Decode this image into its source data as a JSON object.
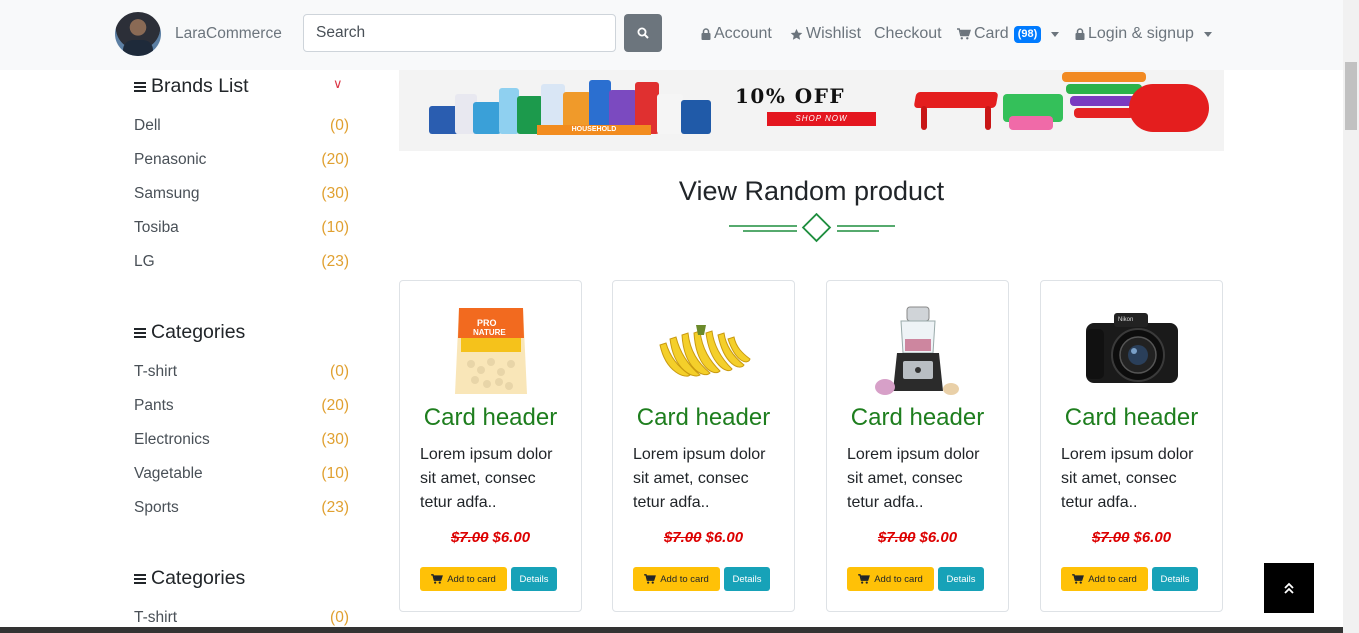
{
  "nav": {
    "brand": "LaraCommerce",
    "search_placeholder": "Search",
    "account": "Account",
    "wishlist": "Wishlist",
    "checkout": "Checkout",
    "card": "Card",
    "card_count": "(98)",
    "login": "Login & signup"
  },
  "sidebar": {
    "brands_title": "Brands List",
    "brands": [
      {
        "name": "Dell",
        "count": "(0)"
      },
      {
        "name": "Penasonic",
        "count": "(20)"
      },
      {
        "name": "Samsung",
        "count": "(30)"
      },
      {
        "name": "Tosiba",
        "count": "(10)"
      },
      {
        "name": "LG",
        "count": "(23)"
      }
    ],
    "categories_title": "Categories",
    "categories": [
      {
        "name": "T-shirt",
        "count": "(0)"
      },
      {
        "name": "Pants",
        "count": "(20)"
      },
      {
        "name": "Electronics",
        "count": "(30)"
      },
      {
        "name": "Vagetable",
        "count": "(10)"
      },
      {
        "name": "Sports",
        "count": "(23)"
      }
    ],
    "categories2_title": "Categories",
    "categories2": [
      {
        "name": "T-shirt",
        "count": "(0)"
      }
    ]
  },
  "banner": {
    "label": "HOUSEHOLD",
    "offer": "10% OFF",
    "cta": "SHOP NOW"
  },
  "main": {
    "section_title": "View Random product",
    "products": [
      {
        "image": "grocery-bag",
        "header": "Card header",
        "text": "Lorem ipsum dolor sit amet, consec tetur adfa..",
        "old_price": "$7.00",
        "price": "$6.00",
        "add_label": "Add to card",
        "details_label": "Details"
      },
      {
        "image": "bananas",
        "header": "Card header",
        "text": "Lorem ipsum dolor sit amet, consec tetur adfa..",
        "old_price": "$7.00",
        "price": "$6.00",
        "add_label": "Add to card",
        "details_label": "Details"
      },
      {
        "image": "food-processor",
        "header": "Card header",
        "text": "Lorem ipsum dolor sit amet, consec tetur adfa..",
        "old_price": "$7.00",
        "price": "$6.00",
        "add_label": "Add to card",
        "details_label": "Details"
      },
      {
        "image": "camera",
        "header": "Card header",
        "text": "Lorem ipsum dolor sit amet, consec tetur adfa..",
        "old_price": "$7.00",
        "price": "$6.00",
        "add_label": "Add to card",
        "details_label": "Details"
      }
    ]
  },
  "colors": {
    "accent_green": "#1e7e1e",
    "price_red": "#dc0000",
    "add_button": "#ffc107",
    "details_button": "#17a2b8",
    "badge_blue": "#007bff"
  }
}
